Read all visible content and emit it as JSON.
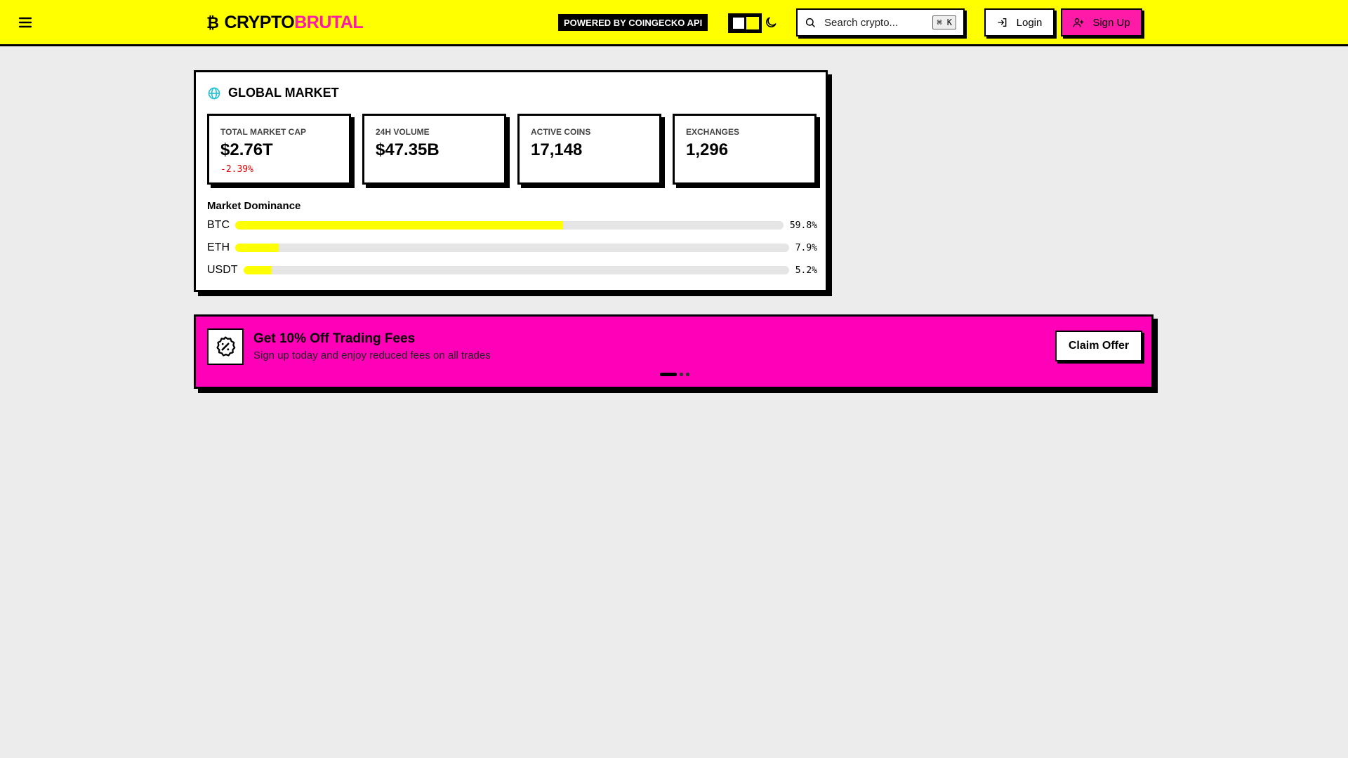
{
  "header": {
    "logo_part1": "CRYPTO",
    "logo_part2": "BRUTAL",
    "powered_by": "POWERED BY COINGECKO API",
    "search_placeholder": "Search crypto...",
    "search_shortcut": "⌘ K",
    "login_label": "Login",
    "signup_label": "Sign Up"
  },
  "market": {
    "title": "GLOBAL MARKET",
    "stats": [
      {
        "label": "TOTAL MARKET CAP",
        "value": "$2.76T",
        "change": "-2.39%"
      },
      {
        "label": "24H VOLUME",
        "value": "$47.35B"
      },
      {
        "label": "ACTIVE COINS",
        "value": "17,148"
      },
      {
        "label": "EXCHANGES",
        "value": "1,296"
      }
    ],
    "dominance_title": "Market Dominance",
    "dominance": [
      {
        "symbol": "BTC",
        "percent": 59.8,
        "label": "59.8%"
      },
      {
        "symbol": "ETH",
        "percent": 7.9,
        "label": "7.9%"
      },
      {
        "symbol": "USDT",
        "percent": 5.2,
        "label": "5.2%"
      }
    ]
  },
  "promo": {
    "title": "Get 10% Off Trading Fees",
    "subtitle": "Sign up today and enjoy reduced fees on all trades",
    "button_label": "Claim Offer",
    "active_slide": 1,
    "slide_count": 3
  },
  "colors": {
    "accent_yellow": "#ffff00",
    "accent_pink": "#ff1aa8",
    "promo_bg": "#ff00b8",
    "negative": "#e00000",
    "globe_icon": "#22c3d6"
  },
  "icons": {
    "menu": "hamburger-icon",
    "logo": "bitcoin-icon",
    "theme": "moon-icon",
    "search": "search-icon",
    "login": "login-icon",
    "signup": "user-plus-icon",
    "market": "globe-icon",
    "promo": "percent-badge-icon"
  }
}
